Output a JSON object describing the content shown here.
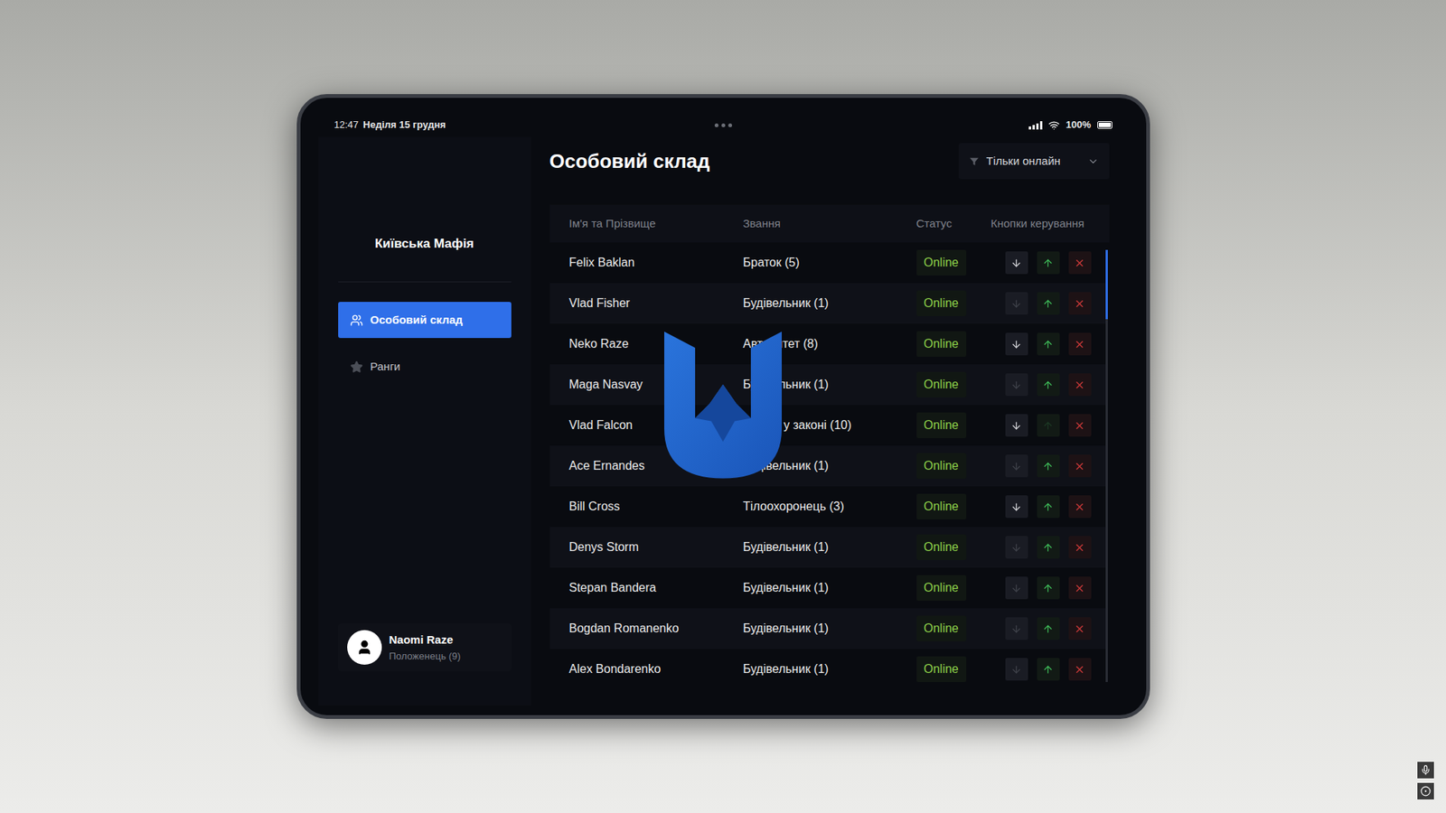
{
  "status_bar": {
    "time": "12:47",
    "date": "Неділя 15 грудня",
    "battery": "100%",
    "battery_level": 1
  },
  "sidebar": {
    "org": "Київська Мафія",
    "items": [
      {
        "label": "Особовий склад",
        "selected": true
      },
      {
        "label": "Ранги",
        "selected": false
      }
    ],
    "user": {
      "name": "Naomi Raze",
      "rank": "Положенець (9)"
    }
  },
  "page": {
    "title": "Особовий склад",
    "filter": "Тільки онлайн"
  },
  "table": {
    "columns": [
      "Ім'я та Прізвище",
      "Звання",
      "Статус",
      "Кнопки керування"
    ],
    "rows": [
      {
        "name": "Felix Baklan",
        "rank": "Браток (5)",
        "status": "Online",
        "can_demote": true,
        "can_promote": true
      },
      {
        "name": "Vlad Fisher",
        "rank": "Будівельник (1)",
        "status": "Online",
        "can_demote": false,
        "can_promote": true
      },
      {
        "name": "Neko Raze",
        "rank": "Авторитет (8)",
        "status": "Online",
        "can_demote": true,
        "can_promote": true
      },
      {
        "name": "Maga Nasvay",
        "rank": "Будівельник (1)",
        "status": "Online",
        "can_demote": false,
        "can_promote": true
      },
      {
        "name": "Vlad Falcon",
        "rank": "Злодій у законі (10)",
        "status": "Online",
        "can_demote": true,
        "can_promote": false
      },
      {
        "name": "Ace Ernandes",
        "rank": "Будівельник (1)",
        "status": "Online",
        "can_demote": false,
        "can_promote": true
      },
      {
        "name": "Bill Cross",
        "rank": "Тілоохоронець (3)",
        "status": "Online",
        "can_demote": true,
        "can_promote": true
      },
      {
        "name": "Denys Storm",
        "rank": "Будівельник (1)",
        "status": "Online",
        "can_demote": false,
        "can_promote": true
      },
      {
        "name": "Stepan Bandera",
        "rank": "Будівельник (1)",
        "status": "Online",
        "can_demote": false,
        "can_promote": true
      },
      {
        "name": "Bogdan Romanenko",
        "rank": "Будівельник (1)",
        "status": "Online",
        "can_demote": false,
        "can_promote": true
      },
      {
        "name": "Alex Bondarenko",
        "rank": "Будівельник (1)",
        "status": "Online",
        "can_demote": false,
        "can_promote": true
      }
    ],
    "scrollbar": {
      "level": 0.16
    }
  }
}
